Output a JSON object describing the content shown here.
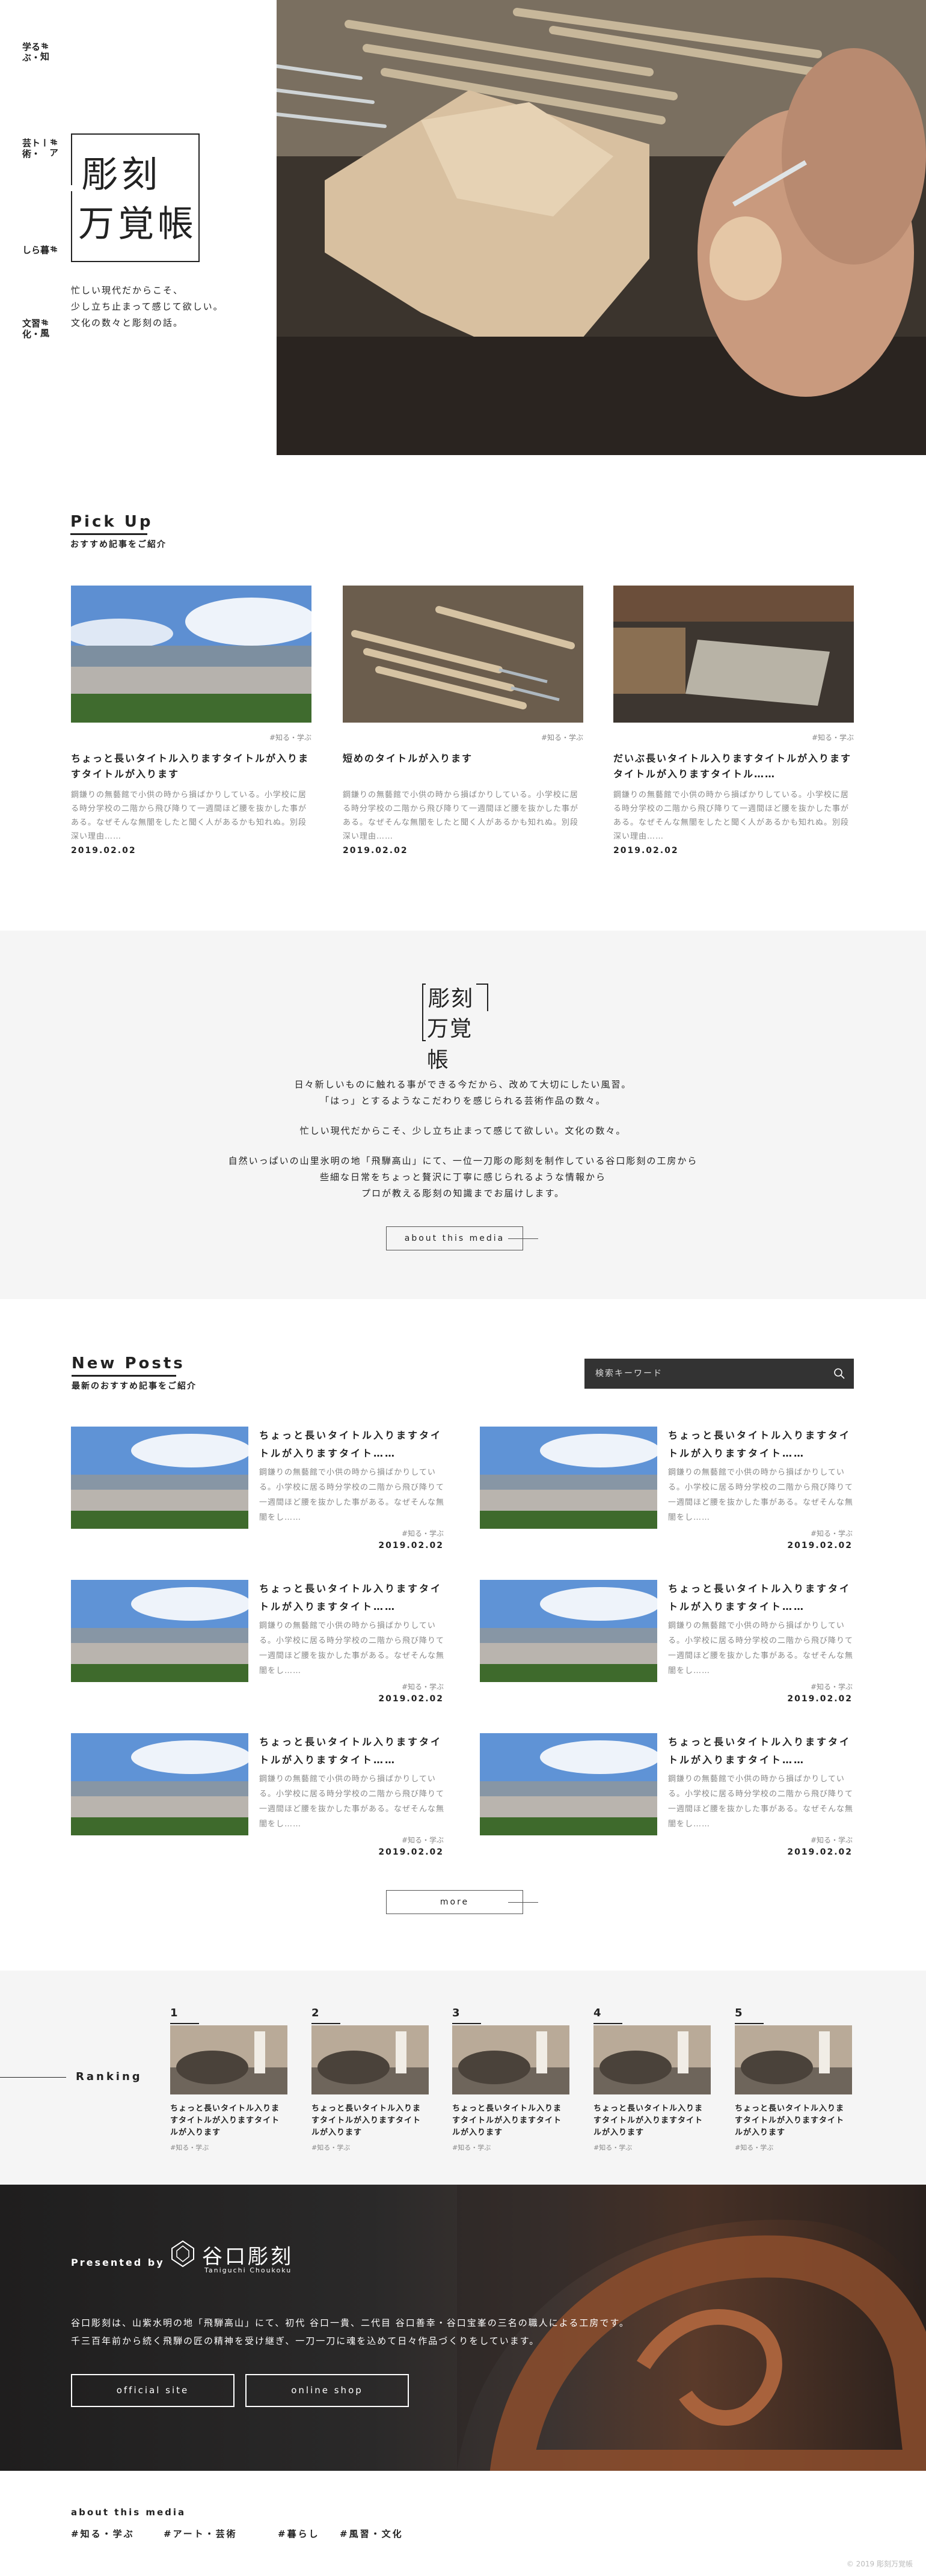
{
  "hero": {
    "nav": [
      "#知る・学ぶ",
      "#アート・芸術",
      "#暮らし",
      "#風習・文化"
    ],
    "logo_line1": "彫刻",
    "logo_line2": "万覚帳",
    "tagline": [
      "忙しい現代だからこそ、",
      "少し立ち止まって感じて欲しい。",
      "文化の数々と彫刻の話。"
    ]
  },
  "pickup": {
    "title": "Pick Up",
    "subtitle": "おすすめ記事をご紹介",
    "cards": [
      {
        "tag": "#知る・学ぶ",
        "title": "ちょっと長いタイトル入りますタイトルが入りますタイトルが入ります",
        "desc": "鋼鎌りの無藝館で小供の時から損ばかりしている。小学校に居る時分学校の二階から飛び降りて一週間ほど腰を抜かした事がある。なぜそんな無闇をしたと聞く人があるかも知れぬ。別段深い理由……",
        "date": "2019.02.02"
      },
      {
        "tag": "#知る・学ぶ",
        "title": "短めのタイトルが入ります",
        "desc": "鋼鎌りの無藝館で小供の時から損ばかりしている。小学校に居る時分学校の二階から飛び降りて一週間ほど腰を抜かした事がある。なぜそんな無闇をしたと聞く人があるかも知れぬ。別段深い理由……",
        "date": "2019.02.02"
      },
      {
        "tag": "#知る・学ぶ",
        "title": "だいぶ長いタイトル入りますタイトルが入りますタイトルが入りますタイトル……",
        "desc": "鋼鎌りの無藝館で小供の時から損ばかりしている。小学校に居る時分学校の二階から飛び降りて一週間ほど腰を抜かした事がある。なぜそんな無闇をしたと聞く人があるかも知れぬ。別段深い理由……",
        "date": "2019.02.02"
      }
    ]
  },
  "about": {
    "logo_line1": "彫刻",
    "logo_line2": "万覚帳",
    "para1": [
      "日々新しいものに触れる事ができる今だから、改めて大切にしたい風習。",
      "「はっ」とするようなこだわりを感じられる芸術作品の数々。"
    ],
    "para2": "忙しい現代だからこそ、少し立ち止まって感じて欲しい。文化の数々。",
    "para3": [
      "自然いっぱいの山里氷明の地「飛騨高山」にて、一位一刀彫の彫刻を制作している谷口彫刻の工房から",
      "些細な日常をちょっと贅沢に丁寧に感じられるような情報から",
      "プロが教える彫刻の知識までお届けします。"
    ],
    "button": "about this media"
  },
  "newposts": {
    "title": "New Posts",
    "subtitle": "最新のおすすめ記事をご紹介",
    "search_placeholder": "検索キーワード",
    "posts": [
      {
        "title": "ちょっと長いタイトル入りますタイトルが入りますタイト……",
        "desc": "鋼鎌りの無藝館で小供の時から損ばかりしている。小学校に居る時分学校の二階から飛び降りて一週間ほど腰を抜かした事がある。なぜそんな無闇をし……",
        "tag": "#知る・学ぶ",
        "date": "2019.02.02"
      },
      {
        "title": "ちょっと長いタイトル入りますタイトルが入りますタイト……",
        "desc": "鋼鎌りの無藝館で小供の時から損ばかりしている。小学校に居る時分学校の二階から飛び降りて一週間ほど腰を抜かした事がある。なぜそんな無闇をし……",
        "tag": "#知る・学ぶ",
        "date": "2019.02.02"
      },
      {
        "title": "ちょっと長いタイトル入りますタイトルが入りますタイト……",
        "desc": "鋼鎌りの無藝館で小供の時から損ばかりしている。小学校に居る時分学校の二階から飛び降りて一週間ほど腰を抜かした事がある。なぜそんな無闇をし……",
        "tag": "#知る・学ぶ",
        "date": "2019.02.02"
      },
      {
        "title": "ちょっと長いタイトル入りますタイトルが入りますタイト……",
        "desc": "鋼鎌りの無藝館で小供の時から損ばかりしている。小学校に居る時分学校の二階から飛び降りて一週間ほど腰を抜かした事がある。なぜそんな無闇をし……",
        "tag": "#知る・学ぶ",
        "date": "2019.02.02"
      },
      {
        "title": "ちょっと長いタイトル入りますタイトルが入りますタイト……",
        "desc": "鋼鎌りの無藝館で小供の時から損ばかりしている。小学校に居る時分学校の二階から飛び降りて一週間ほど腰を抜かした事がある。なぜそんな無闇をし……",
        "tag": "#知る・学ぶ",
        "date": "2019.02.02"
      },
      {
        "title": "ちょっと長いタイトル入りますタイトルが入りますタイト……",
        "desc": "鋼鎌りの無藝館で小供の時から損ばかりしている。小学校に居る時分学校の二階から飛び降りて一週間ほど腰を抜かした事がある。なぜそんな無闇をし……",
        "tag": "#知る・学ぶ",
        "date": "2019.02.02"
      }
    ],
    "more_button": "more"
  },
  "ranking": {
    "label": "Ranking",
    "items": [
      {
        "num": "1",
        "title": "ちょっと長いタイトル入りますタイトルが入りますタイトルが入ります",
        "tag": "#知る・学ぶ"
      },
      {
        "num": "2",
        "title": "ちょっと長いタイトル入りますタイトルが入りますタイトルが入ります",
        "tag": "#知る・学ぶ"
      },
      {
        "num": "3",
        "title": "ちょっと長いタイトル入りますタイトルが入りますタイトルが入ります",
        "tag": "#知る・学ぶ"
      },
      {
        "num": "4",
        "title": "ちょっと長いタイトル入りますタイトルが入りますタイトルが入ります",
        "tag": "#知る・学ぶ"
      },
      {
        "num": "5",
        "title": "ちょっと長いタイトル入りますタイトルが入りますタイトルが入ります",
        "tag": "#知る・学ぶ"
      }
    ]
  },
  "presented": {
    "label": "Presented by",
    "brand": "谷口彫刻",
    "brand_sub": "Taniguchi Choukoku",
    "body": [
      "谷口彫刻は、山紫水明の地「飛騨高山」にて、初代 谷口一貴、二代目 谷口善幸・谷口宝峯の三名の職人による工房です。",
      "千三百年前から続く飛騨の匠の精神を受け継ぎ、一刀一刀に魂を込めて日々作品づくりをしています。"
    ],
    "btn_official": "official site",
    "btn_shop": "online shop"
  },
  "footer": {
    "label": "about this media",
    "links": [
      "#知る・学ぶ",
      "#アート・芸術",
      "#暮らし",
      "#風習・文化"
    ],
    "copyright": "© 2019 彫刻万覚帳"
  },
  "colors": {
    "text": "#222222",
    "muted": "#888888",
    "section_bg": "#f5f5f5",
    "dark": "#333333"
  }
}
